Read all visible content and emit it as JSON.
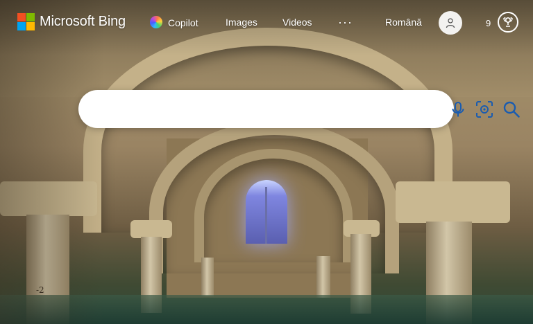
{
  "header": {
    "brand": "Microsoft Bing",
    "logo_colors": [
      "#f25022",
      "#7fba00",
      "#00a4ef",
      "#ffb900"
    ],
    "nav": {
      "copilot": "Copilot",
      "images": "Images",
      "videos": "Videos",
      "more": "···"
    },
    "language": "Română",
    "rewards_points": "9",
    "icons": {
      "copilot": "copilot-icon",
      "account": "user-avatar-icon",
      "rewards": "rewards-trophy-icon"
    }
  },
  "search": {
    "value": "",
    "placeholder": "",
    "icons": [
      "microphone-icon",
      "visual-search-icon",
      "search-icon"
    ],
    "accent": "#1a5cb0"
  },
  "background": {
    "caption_mark": "-2"
  }
}
